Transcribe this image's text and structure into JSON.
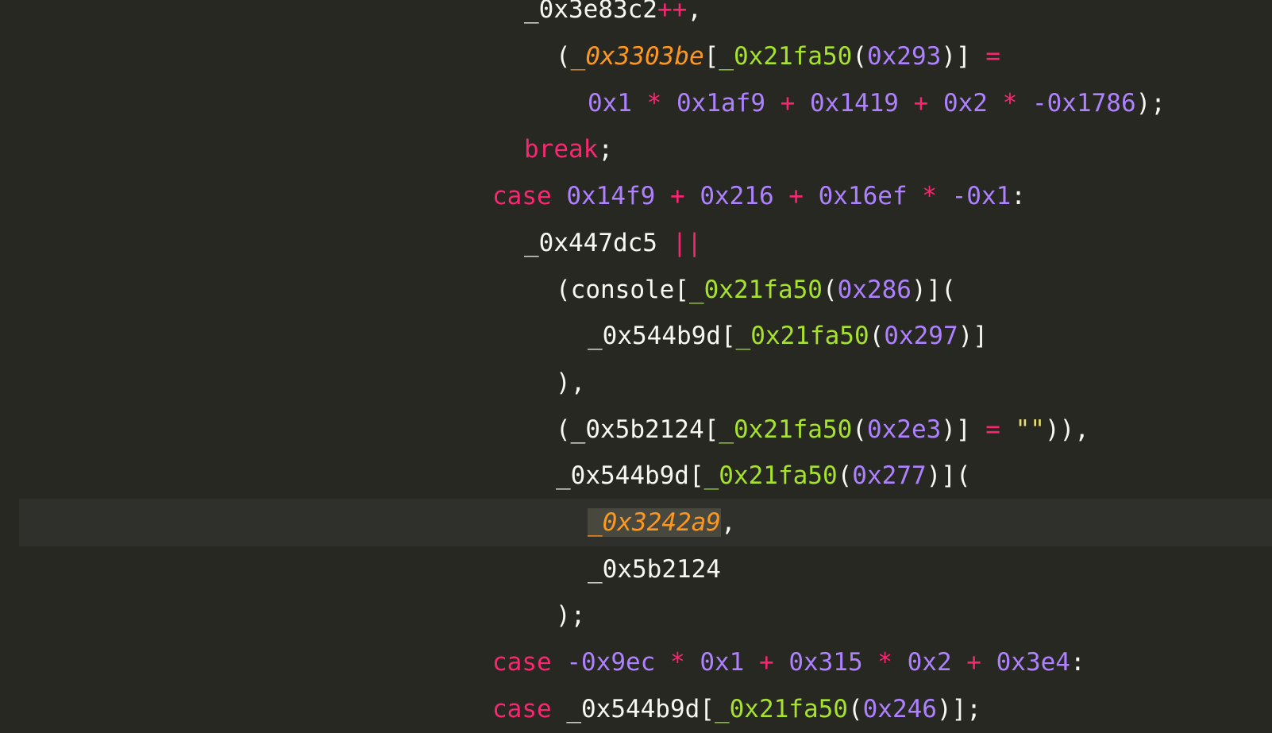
{
  "editor": {
    "colors": {
      "background": "#272822",
      "keyword": "#f92672",
      "number": "#ae81ff",
      "function": "#a6e22e",
      "parameter": "#fd971f",
      "string": "#e6db74",
      "text": "#f8f8f2",
      "current_line": "#2f302b",
      "selection": "#49483e"
    },
    "gutter_icon": "lightbulb-icon",
    "lines": [
      [
        {
          "t": "_0x3e83c2",
          "c": "var"
        },
        {
          "t": "++",
          "c": "op"
        },
        {
          "t": ",",
          "c": "punc"
        }
      ],
      [
        {
          "t": "(",
          "c": "punc"
        },
        {
          "t": "_0x3303be",
          "c": "param"
        },
        {
          "t": "[",
          "c": "punc"
        },
        {
          "t": "_0x21fa50",
          "c": "fn"
        },
        {
          "t": "(",
          "c": "punc"
        },
        {
          "t": "0x293",
          "c": "num"
        },
        {
          "t": ")] ",
          "c": "punc"
        },
        {
          "t": "=",
          "c": "op"
        }
      ],
      [
        {
          "t": "0x1",
          "c": "num"
        },
        {
          "t": " * ",
          "c": "op"
        },
        {
          "t": "0x1af9",
          "c": "num"
        },
        {
          "t": " + ",
          "c": "op"
        },
        {
          "t": "0x1419",
          "c": "num"
        },
        {
          "t": " + ",
          "c": "op"
        },
        {
          "t": "0x2",
          "c": "num"
        },
        {
          "t": " * ",
          "c": "op"
        },
        {
          "t": "-0x1786",
          "c": "num"
        },
        {
          "t": ");",
          "c": "punc"
        }
      ],
      [
        {
          "t": "break",
          "c": "kw"
        },
        {
          "t": ";",
          "c": "punc"
        }
      ],
      [
        {
          "t": "case",
          "c": "kw"
        },
        {
          "t": " ",
          "c": "punc"
        },
        {
          "t": "0x14f9",
          "c": "num"
        },
        {
          "t": " + ",
          "c": "op"
        },
        {
          "t": "0x216",
          "c": "num"
        },
        {
          "t": " + ",
          "c": "op"
        },
        {
          "t": "0x16ef",
          "c": "num"
        },
        {
          "t": " * ",
          "c": "op"
        },
        {
          "t": "-0x1",
          "c": "num"
        },
        {
          "t": ":",
          "c": "punc"
        }
      ],
      [
        {
          "t": "_0x447dc5",
          "c": "var"
        },
        {
          "t": " ||",
          "c": "op"
        }
      ],
      [
        {
          "t": "(console[",
          "c": "punc"
        },
        {
          "t": "_0x21fa50",
          "c": "fn"
        },
        {
          "t": "(",
          "c": "punc"
        },
        {
          "t": "0x286",
          "c": "num"
        },
        {
          "t": ")](",
          "c": "punc"
        }
      ],
      [
        {
          "t": "_0x544b9d[",
          "c": "var"
        },
        {
          "t": "_0x21fa50",
          "c": "fn"
        },
        {
          "t": "(",
          "c": "punc"
        },
        {
          "t": "0x297",
          "c": "num"
        },
        {
          "t": ")]",
          "c": "punc"
        }
      ],
      [
        {
          "t": "),",
          "c": "punc"
        }
      ],
      [
        {
          "t": "(_0x5b2124[",
          "c": "var"
        },
        {
          "t": "_0x21fa50",
          "c": "fn"
        },
        {
          "t": "(",
          "c": "punc"
        },
        {
          "t": "0x2e3",
          "c": "num"
        },
        {
          "t": ")] ",
          "c": "punc"
        },
        {
          "t": "=",
          "c": "op"
        },
        {
          "t": " ",
          "c": "punc"
        },
        {
          "t": "\"\"",
          "c": "str"
        },
        {
          "t": ")),",
          "c": "punc"
        }
      ],
      [
        {
          "t": "_0x544b9d[",
          "c": "var"
        },
        {
          "t": "_0x21fa50",
          "c": "fn"
        },
        {
          "t": "(",
          "c": "punc"
        },
        {
          "t": "0x277",
          "c": "num"
        },
        {
          "t": ")](",
          "c": "punc"
        }
      ],
      [
        {
          "t": "_0x3242a9",
          "c": "param sel"
        },
        {
          "t": ",",
          "c": "punc"
        }
      ],
      [
        {
          "t": "_0x5b2124",
          "c": "var"
        }
      ],
      [
        {
          "t": ");",
          "c": "punc"
        }
      ],
      [
        {
          "t": "case",
          "c": "kw"
        },
        {
          "t": " ",
          "c": "punc"
        },
        {
          "t": "-0x9ec",
          "c": "num"
        },
        {
          "t": " * ",
          "c": "op"
        },
        {
          "t": "0x1",
          "c": "num"
        },
        {
          "t": " + ",
          "c": "op"
        },
        {
          "t": "0x315",
          "c": "num"
        },
        {
          "t": " * ",
          "c": "op"
        },
        {
          "t": "0x2",
          "c": "num"
        },
        {
          "t": " + ",
          "c": "op"
        },
        {
          "t": "0x3e4",
          "c": "num"
        },
        {
          "t": ":",
          "c": "punc"
        }
      ],
      [
        {
          "t": "case",
          "c": "kw"
        },
        {
          "t": " ",
          "c": "punc"
        },
        {
          "t": "_0x544b9d[",
          "c": "var"
        },
        {
          "t": "_0x21fa50",
          "c": "fn"
        },
        {
          "t": "(",
          "c": "punc"
        },
        {
          "t": "0x246",
          "c": "num"
        },
        {
          "t": ")];",
          "c": "punc"
        }
      ]
    ]
  }
}
